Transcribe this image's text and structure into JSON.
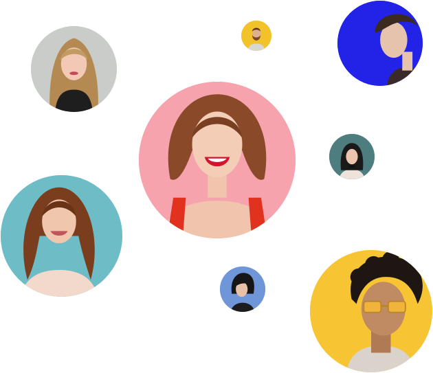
{
  "avatars": [
    {
      "id": "blonde",
      "name": "avatar-woman-blonde",
      "bg": "#c9ccc8"
    },
    {
      "id": "bearded",
      "name": "avatar-man-bearded",
      "bg": "#f2c22b"
    },
    {
      "id": "blue",
      "name": "avatar-man-blue-background",
      "bg": "#2323e8"
    },
    {
      "id": "pink",
      "name": "avatar-woman-smiling-pink",
      "bg": "#f6a3ad"
    },
    {
      "id": "teal-small",
      "name": "avatar-woman-teal-small",
      "bg": "#4e7d80"
    },
    {
      "id": "teal-big",
      "name": "avatar-woman-teal-large",
      "bg": "#6ebcc6"
    },
    {
      "id": "bob",
      "name": "avatar-woman-bob-haircut",
      "bg": "#6f96d8"
    },
    {
      "id": "yellow",
      "name": "avatar-man-yellow-sunglasses",
      "bg": "#f7c534"
    }
  ]
}
